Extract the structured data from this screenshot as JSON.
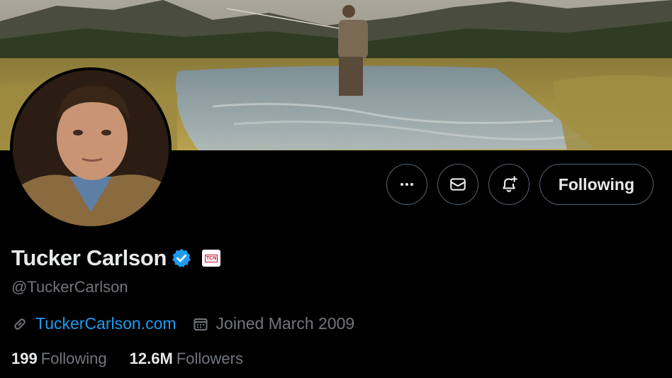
{
  "profile": {
    "display_name": "Tucker Carlson",
    "handle": "@TuckerCarlson",
    "affiliation_badge_text": "TCN",
    "website": "TuckerCarlson.com",
    "joined": "Joined March 2009",
    "following_count": "199",
    "following_label": "Following",
    "followers_count": "12.6M",
    "followers_label": "Followers"
  },
  "actions": {
    "more_icon": "more-horizontal-icon",
    "message_icon": "envelope-icon",
    "notify_icon": "bell-plus-icon",
    "follow_label": "Following"
  },
  "colors": {
    "background": "#000000",
    "primary_text": "#e7e9ea",
    "secondary_text": "#71767b",
    "link": "#1d9bf0",
    "verified": "#1d9bf0",
    "button_border": "#536471"
  }
}
